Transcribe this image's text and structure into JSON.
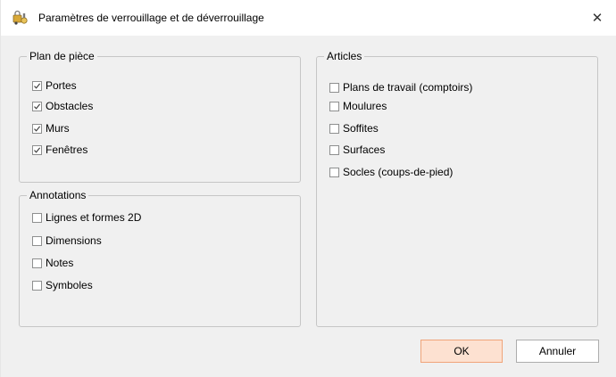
{
  "window": {
    "title": "Paramètres de verrouillage et de déverrouillage",
    "icon": "lock-settings-icon",
    "close_glyph": "✕"
  },
  "groups": {
    "plan": {
      "legend": "Plan de pièce",
      "items": [
        {
          "label": "Portes",
          "checked": true
        },
        {
          "label": "Obstacles",
          "checked": true
        },
        {
          "label": "Murs",
          "checked": true
        },
        {
          "label": "Fenêtres",
          "checked": true
        }
      ]
    },
    "annotations": {
      "legend": "Annotations",
      "items": [
        {
          "label": "Lignes et formes 2D",
          "checked": false
        },
        {
          "label": "Dimensions",
          "checked": false
        },
        {
          "label": "Notes",
          "checked": false
        },
        {
          "label": "Symboles",
          "checked": false
        }
      ]
    },
    "articles": {
      "legend": "Articles",
      "items": [
        {
          "label": "Plans de travail (comptoirs)",
          "checked": false
        },
        {
          "label": "Moulures",
          "checked": false
        },
        {
          "label": "Soffites",
          "checked": false
        },
        {
          "label": "Surfaces",
          "checked": false
        },
        {
          "label": "Socles (coups-de-pied)",
          "checked": false
        }
      ]
    }
  },
  "buttons": {
    "ok": "OK",
    "cancel": "Annuler"
  },
  "colors": {
    "dialog_bg": "#f0f0f0",
    "title_bg": "#ffffff",
    "ok_bg": "#fde1d1",
    "ok_border": "#f0a47a",
    "group_border": "#c6c6c6"
  }
}
